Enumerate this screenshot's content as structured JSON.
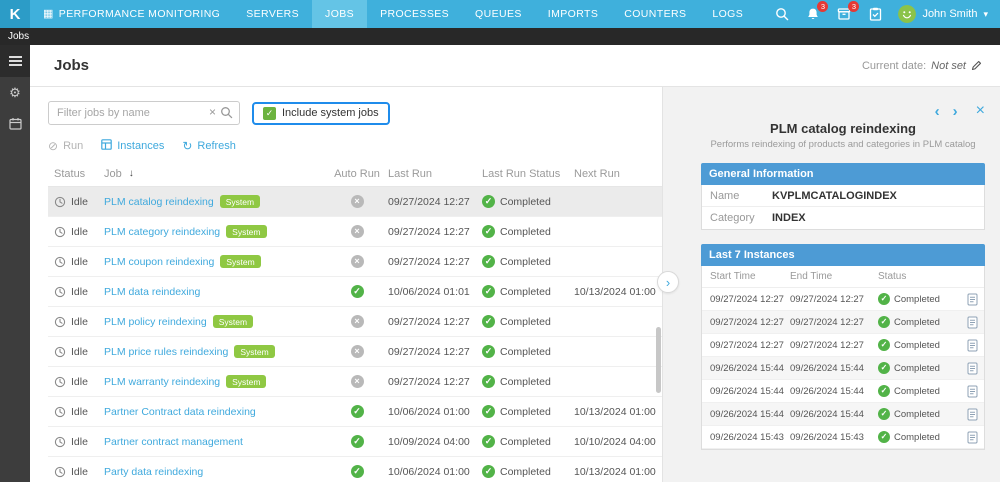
{
  "topbar": {
    "logo": "K",
    "menu": [
      {
        "label": "PERFORMANCE MONITORING",
        "active": false,
        "icon": "grid"
      },
      {
        "label": "SERVERS",
        "active": false
      },
      {
        "label": "JOBS",
        "active": true
      },
      {
        "label": "PROCESSES",
        "active": false
      },
      {
        "label": "QUEUES",
        "active": false
      },
      {
        "label": "IMPORTS",
        "active": false
      },
      {
        "label": "COUNTERS",
        "active": false
      },
      {
        "label": "LOGS",
        "active": false
      }
    ],
    "notifications_badge": "3",
    "modules_badge": "3",
    "user_name": "John Smith"
  },
  "breadcrumb": "Jobs",
  "page": {
    "title": "Jobs",
    "current_date_label": "Current date:",
    "current_date_value": "Not set"
  },
  "filters": {
    "search_placeholder": "Filter jobs by name",
    "include_system_jobs_label": "Include system jobs",
    "include_system_jobs_checked": true
  },
  "toolbar": {
    "run": "Run",
    "instances": "Instances",
    "refresh": "Refresh"
  },
  "table": {
    "columns": [
      "Status",
      "Job",
      "Auto Run",
      "Last Run",
      "Last Run Status",
      "Next Run"
    ],
    "system_badge": "System",
    "rows": [
      {
        "status": "Idle",
        "job": "PLM catalog reindexing",
        "system": true,
        "auto_run": false,
        "last_run": "09/27/2024 12:27",
        "last_run_status": "Completed",
        "next_run": "",
        "selected": true
      },
      {
        "status": "Idle",
        "job": "PLM category reindexing",
        "system": true,
        "auto_run": false,
        "last_run": "09/27/2024 12:27",
        "last_run_status": "Completed",
        "next_run": "",
        "selected": false
      },
      {
        "status": "Idle",
        "job": "PLM coupon reindexing",
        "system": true,
        "auto_run": false,
        "last_run": "09/27/2024 12:27",
        "last_run_status": "Completed",
        "next_run": "",
        "selected": false
      },
      {
        "status": "Idle",
        "job": "PLM data reindexing",
        "system": false,
        "auto_run": true,
        "last_run": "10/06/2024 01:01",
        "last_run_status": "Completed",
        "next_run": "10/13/2024 01:00",
        "selected": false
      },
      {
        "status": "Idle",
        "job": "PLM policy reindexing",
        "system": true,
        "auto_run": false,
        "last_run": "09/27/2024 12:27",
        "last_run_status": "Completed",
        "next_run": "",
        "selected": false
      },
      {
        "status": "Idle",
        "job": "PLM price rules reindexing",
        "system": true,
        "auto_run": false,
        "last_run": "09/27/2024 12:27",
        "last_run_status": "Completed",
        "next_run": "",
        "selected": false
      },
      {
        "status": "Idle",
        "job": "PLM warranty reindexing",
        "system": true,
        "auto_run": false,
        "last_run": "09/27/2024 12:27",
        "last_run_status": "Completed",
        "next_run": "",
        "selected": false
      },
      {
        "status": "Idle",
        "job": "Partner Contract data reindexing",
        "system": false,
        "auto_run": true,
        "last_run": "10/06/2024 01:00",
        "last_run_status": "Completed",
        "next_run": "10/13/2024 01:00",
        "selected": false
      },
      {
        "status": "Idle",
        "job": "Partner contract management",
        "system": false,
        "auto_run": true,
        "last_run": "10/09/2024 04:00",
        "last_run_status": "Completed",
        "next_run": "10/10/2024 04:00",
        "selected": false
      },
      {
        "status": "Idle",
        "job": "Party data reindexing",
        "system": false,
        "auto_run": true,
        "last_run": "10/06/2024 01:00",
        "last_run_status": "Completed",
        "next_run": "10/13/2024 01:00",
        "selected": false
      }
    ]
  },
  "panel": {
    "title": "PLM catalog reindexing",
    "subtitle": "Performs reindexing of products and categories in PLM catalog",
    "general_info": {
      "header": "General Information",
      "rows": [
        {
          "label": "Name",
          "value": "KVPLMCATALOGINDEX"
        },
        {
          "label": "Category",
          "value": "INDEX"
        }
      ]
    },
    "instances": {
      "header": "Last 7 Instances",
      "columns": [
        "Start Time",
        "End Time",
        "Status"
      ],
      "rows": [
        {
          "start": "09/27/2024 12:27",
          "end": "09/27/2024 12:27",
          "status": "Completed"
        },
        {
          "start": "09/27/2024 12:27",
          "end": "09/27/2024 12:27",
          "status": "Completed"
        },
        {
          "start": "09/27/2024 12:27",
          "end": "09/27/2024 12:27",
          "status": "Completed"
        },
        {
          "start": "09/26/2024 15:44",
          "end": "09/26/2024 15:44",
          "status": "Completed"
        },
        {
          "start": "09/26/2024 15:44",
          "end": "09/26/2024 15:44",
          "status": "Completed"
        },
        {
          "start": "09/26/2024 15:44",
          "end": "09/26/2024 15:44",
          "status": "Completed"
        },
        {
          "start": "09/26/2024 15:43",
          "end": "09/26/2024 15:43",
          "status": "Completed"
        }
      ]
    }
  },
  "icons": {
    "grid": "▦",
    "gear": "⚙",
    "chevron_down": "▾",
    "clear": "×",
    "run_disabled": "⊘",
    "refresh": "↻",
    "sort_desc": "↓",
    "prev": "‹",
    "next": "›",
    "close": "×",
    "collapse": "›",
    "check": "✓",
    "cross": "×"
  },
  "colors": {
    "topbar": "#3fb0dc",
    "topbar_active": "#64c4e6",
    "logo_bg": "#2c9cc7",
    "accent": "#3fa9dd",
    "section_header": "#4d9bd5",
    "success": "#52b348",
    "system_badge": "#8fc843",
    "focus_outline": "#1f8ceb",
    "badge_red": "#e53935",
    "sidebar": "#3d3d3d",
    "selected_row": "#ebebeb"
  }
}
